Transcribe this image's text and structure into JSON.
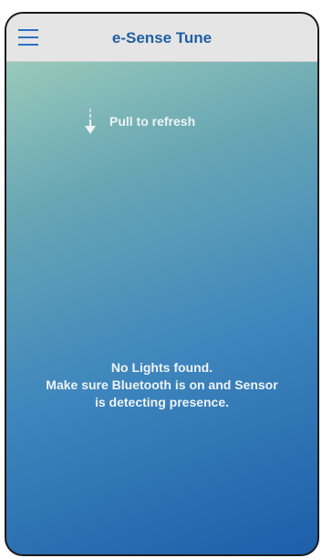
{
  "header": {
    "title": "e-Sense Tune",
    "menu_icon": "hamburger-menu-icon",
    "background": "#e5e5e5",
    "accent": "#1f5fa3"
  },
  "pull_hint": {
    "icon": "arrow-down-icon",
    "text": "Pull to refresh"
  },
  "empty_state": {
    "line1": "No Lights found.",
    "line2": "Make sure Bluetooth is on and Sensor",
    "line3": "is detecting presence."
  },
  "colors": {
    "gradient_top": "#a9d5bd",
    "gradient_bottom": "#1d5ea9",
    "text_light": "#eef3f6"
  }
}
